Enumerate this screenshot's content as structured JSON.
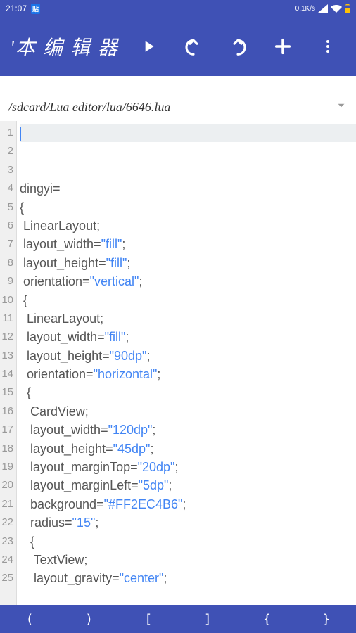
{
  "status": {
    "time": "21:07",
    "net_speed": "0.1K/s"
  },
  "app": {
    "title": "'本 编 辑 器"
  },
  "file_path": "/sdcard/Lua editor/lua/6646.lua",
  "code_lines": [
    {
      "n": "1",
      "tokens": []
    },
    {
      "n": "2",
      "tokens": []
    },
    {
      "n": "3",
      "tokens": []
    },
    {
      "n": "4",
      "tokens": [
        {
          "t": "dingyi="
        }
      ]
    },
    {
      "n": "5",
      "tokens": [
        {
          "t": "{"
        }
      ]
    },
    {
      "n": "6",
      "tokens": [
        {
          "t": " LinearLayout;"
        }
      ]
    },
    {
      "n": "7",
      "tokens": [
        {
          "t": " layout_width="
        },
        {
          "t": "\"fill\"",
          "c": "tok-str"
        },
        {
          "t": ";"
        }
      ]
    },
    {
      "n": "8",
      "tokens": [
        {
          "t": " layout_height="
        },
        {
          "t": "\"fill\"",
          "c": "tok-str"
        },
        {
          "t": ";"
        }
      ]
    },
    {
      "n": "9",
      "tokens": [
        {
          "t": " orientation="
        },
        {
          "t": "\"vertical\"",
          "c": "tok-str"
        },
        {
          "t": ";"
        }
      ]
    },
    {
      "n": "10",
      "tokens": [
        {
          "t": " {"
        }
      ]
    },
    {
      "n": "11",
      "tokens": [
        {
          "t": "  LinearLayout;"
        }
      ]
    },
    {
      "n": "12",
      "tokens": [
        {
          "t": "  layout_width="
        },
        {
          "t": "\"fill\"",
          "c": "tok-str"
        },
        {
          "t": ";"
        }
      ]
    },
    {
      "n": "13",
      "tokens": [
        {
          "t": "  layout_height="
        },
        {
          "t": "\"90dp\"",
          "c": "tok-str"
        },
        {
          "t": ";"
        }
      ]
    },
    {
      "n": "14",
      "tokens": [
        {
          "t": "  orientation="
        },
        {
          "t": "\"horizontal\"",
          "c": "tok-str"
        },
        {
          "t": ";"
        }
      ]
    },
    {
      "n": "15",
      "tokens": [
        {
          "t": "  {"
        }
      ]
    },
    {
      "n": "16",
      "tokens": [
        {
          "t": "   CardView;"
        }
      ]
    },
    {
      "n": "17",
      "tokens": [
        {
          "t": "   layout_width="
        },
        {
          "t": "\"120dp\"",
          "c": "tok-str"
        },
        {
          "t": ";"
        }
      ]
    },
    {
      "n": "18",
      "tokens": [
        {
          "t": "   layout_height="
        },
        {
          "t": "\"45dp\"",
          "c": "tok-str"
        },
        {
          "t": ";"
        }
      ]
    },
    {
      "n": "19",
      "tokens": [
        {
          "t": "   layout_marginTop="
        },
        {
          "t": "\"20dp\"",
          "c": "tok-str"
        },
        {
          "t": ";"
        }
      ]
    },
    {
      "n": "20",
      "tokens": [
        {
          "t": "   layout_marginLeft="
        },
        {
          "t": "\"5dp\"",
          "c": "tok-str"
        },
        {
          "t": ";"
        }
      ]
    },
    {
      "n": "21",
      "tokens": [
        {
          "t": "   background="
        },
        {
          "t": "\"#FF2EC4B6\"",
          "c": "tok-str"
        },
        {
          "t": ";"
        }
      ]
    },
    {
      "n": "22",
      "tokens": [
        {
          "t": "   radius="
        },
        {
          "t": "\"15\"",
          "c": "tok-str"
        },
        {
          "t": ";"
        }
      ]
    },
    {
      "n": "23",
      "tokens": [
        {
          "t": "   {"
        }
      ]
    },
    {
      "n": "24",
      "tokens": [
        {
          "t": "    TextView;"
        }
      ]
    },
    {
      "n": "25",
      "tokens": [
        {
          "t": "    layout_gravity="
        },
        {
          "t": "\"center\"",
          "c": "tok-str"
        },
        {
          "t": ";"
        }
      ]
    }
  ],
  "symbols": [
    "(",
    ")",
    "[",
    "]",
    "{",
    "}"
  ]
}
